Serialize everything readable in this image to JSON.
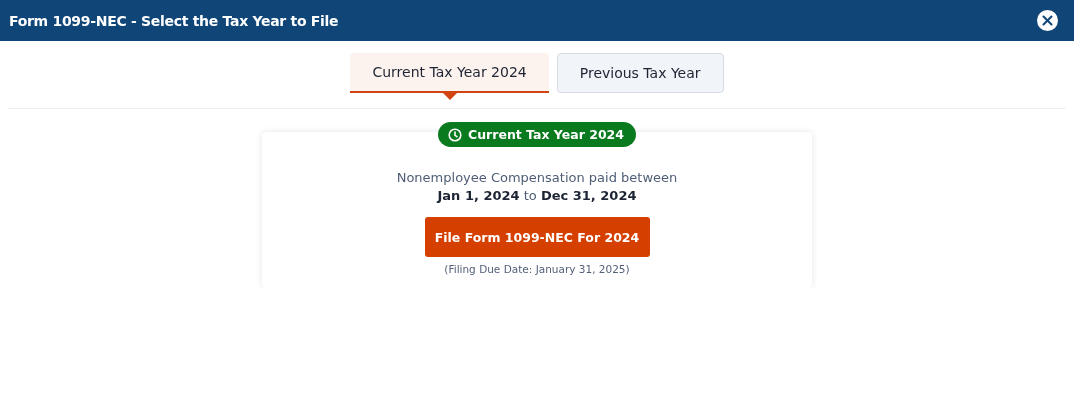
{
  "window": {
    "title": "Form 1099-NEC - Select the Tax Year to File"
  },
  "tabs": [
    {
      "label": "Current Tax Year 2024",
      "selected": true
    },
    {
      "label": "Previous Tax Year",
      "selected": false
    }
  ],
  "card": {
    "badge": "Current Tax Year 2024",
    "description": "Nonemployee Compensation paid between",
    "period": "**Jan 1, 2024** to **Dec 31, 2024**",
    "button": "File Form 1099-NEC For 2024",
    "note": "(Filing Due Date: January 31, 2025)"
  }
}
